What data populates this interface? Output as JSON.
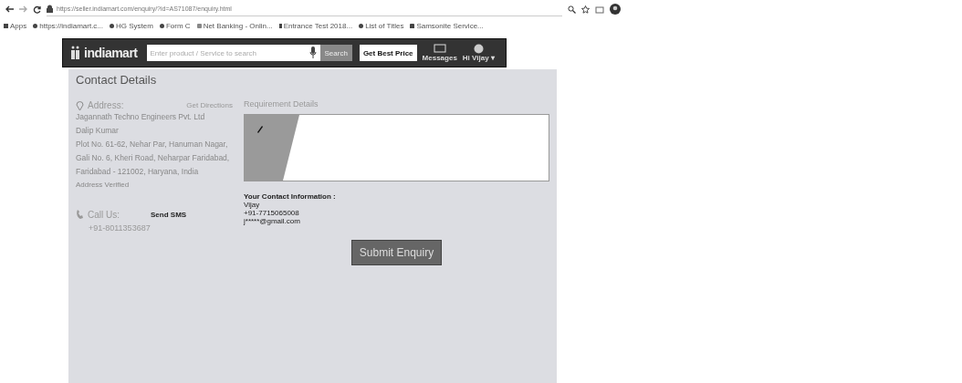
{
  "browser": {
    "url": "https://seller.indiamart.com/enquiry/?id=AS71087/enquiry.html",
    "bookmarks": [
      {
        "label": "Apps",
        "kind": "apps"
      },
      {
        "label": "https://indiamart.c...",
        "kind": "site"
      },
      {
        "label": "HG System",
        "kind": "site"
      },
      {
        "label": "Form C",
        "kind": "site"
      },
      {
        "label": "Net Banking - Onlin...",
        "kind": "bank"
      },
      {
        "label": "Entrance Test 2018...",
        "kind": "doc"
      },
      {
        "label": "List of Titles",
        "kind": "site"
      },
      {
        "label": "Samsonite Service...",
        "kind": "pin"
      }
    ]
  },
  "header": {
    "logo": "indiamart",
    "search_placeholder": "Enter product / Service to search",
    "search_button": "Search",
    "best_price_button": "Get Best Price",
    "messages": "Messages",
    "user": "Hi Vijay ▾"
  },
  "contact": {
    "title": "Contact Details",
    "address_label": "Address:",
    "directions": "Get Directions",
    "address_lines": [
      "Jagannath Techno Engineers Pvt. Ltd",
      "Dalip Kumar",
      "Plot No. 61-62, Nehar Par, Hanuman Nagar, Gali No. 6, Kheri Road, Neharpar Faridabad, Faridabad - 121002, Haryana, India"
    ],
    "verified": "Address Verified",
    "call_label": "Call Us:",
    "sms": "Send SMS",
    "phone": "+91-8011353687"
  },
  "requirement": {
    "label": "Requirement Details",
    "info_title": "Your Contact Information :",
    "info_lines": [
      "Vijay",
      "+91-7715065008",
      "j*****@gmail.com"
    ],
    "submit": "Submit Enquiry"
  }
}
